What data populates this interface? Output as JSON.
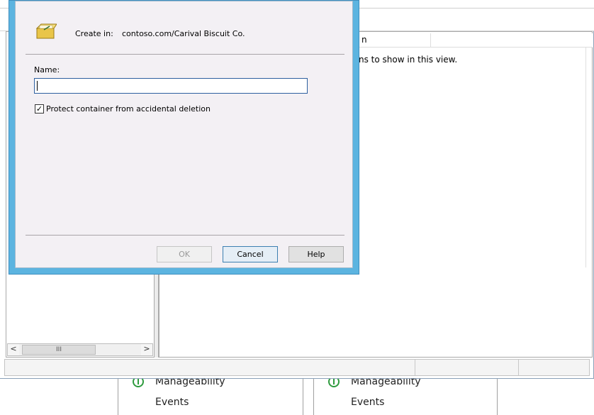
{
  "dialog": {
    "create_in_label": "Create in:",
    "create_in_path": "contoso.com/Carival Biscuit Co.",
    "name_label": "Name:",
    "name_value": "",
    "protect_label": "Protect container from accidental deletion",
    "protect_checked": true,
    "ok_label": "OK",
    "cancel_label": "Cancel",
    "help_label": "Help"
  },
  "background_window": {
    "column_header_partial": "n",
    "empty_message_partial": "ns to show in this view.",
    "scroll_thumb_glyph": "III",
    "scroll_left": "<",
    "scroll_right": ">"
  },
  "background_tiles": [
    {
      "manageability": "Manageability",
      "events": "Events"
    },
    {
      "manageability": "Manageability",
      "events": "Events"
    }
  ],
  "colors": {
    "dialog_frame": "#5cb4e0",
    "dialog_body": "#f3f0f4",
    "status_ok": "#2e9b3e"
  }
}
